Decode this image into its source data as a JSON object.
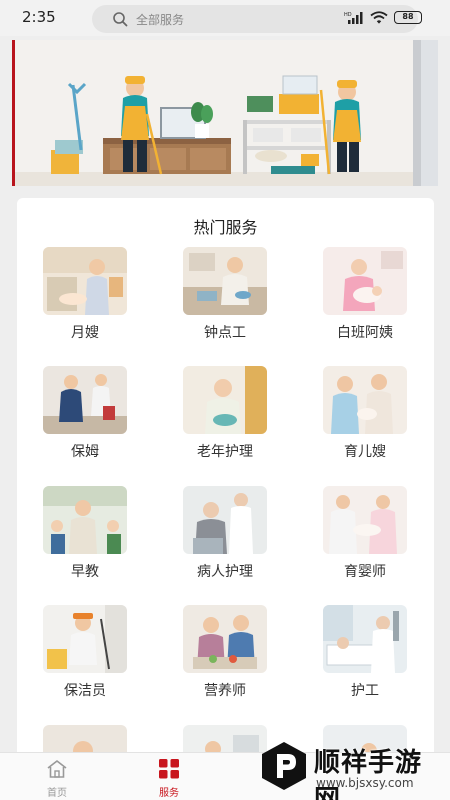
{
  "status_bar": {
    "time": "2:35",
    "battery": "88"
  },
  "search": {
    "placeholder": "全部服务"
  },
  "services_section": {
    "title": "热门服务",
    "items": [
      {
        "label": "月嫂"
      },
      {
        "label": "钟点工"
      },
      {
        "label": "白班阿姨"
      },
      {
        "label": "保姆"
      },
      {
        "label": "老年护理"
      },
      {
        "label": "育儿嫂"
      },
      {
        "label": "早教"
      },
      {
        "label": "病人护理"
      },
      {
        "label": "育婴师"
      },
      {
        "label": "保洁员"
      },
      {
        "label": "营养师"
      },
      {
        "label": "护工"
      }
    ]
  },
  "bottom_nav": {
    "items": [
      {
        "label": "首页",
        "icon": "home-icon",
        "active": false
      },
      {
        "label": "服务",
        "icon": "grid-icon",
        "active": true
      }
    ]
  },
  "watermark": {
    "brand": "顺祥手游网",
    "url": "www.bjsxsy.com"
  },
  "colors": {
    "accent": "#c8151d",
    "inactive": "#999999"
  }
}
